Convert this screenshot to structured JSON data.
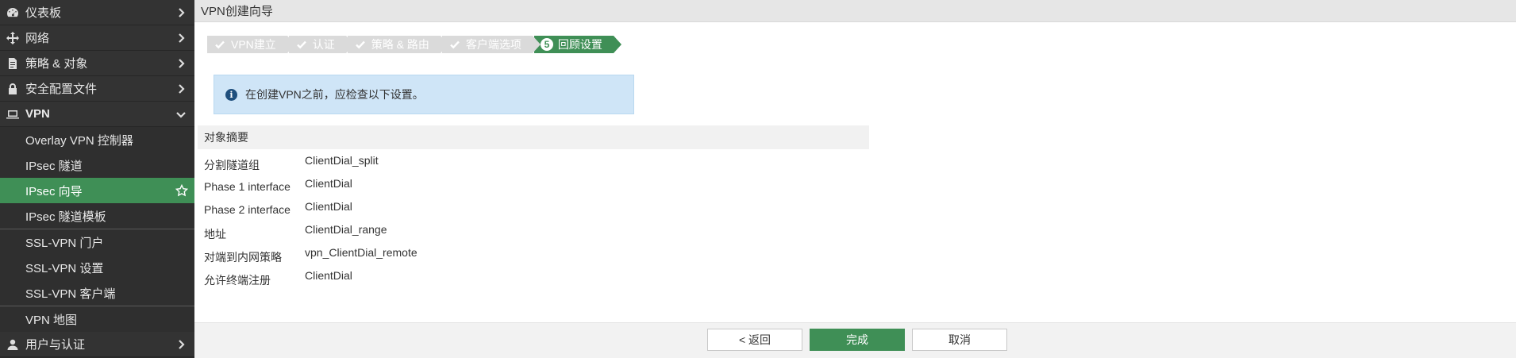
{
  "sidebar": {
    "items": [
      {
        "label": "仪表板",
        "icon": "dashboard-icon"
      },
      {
        "label": "网络",
        "icon": "network-icon"
      },
      {
        "label": "策略 & 对象",
        "icon": "policy-icon"
      },
      {
        "label": "安全配置文件",
        "icon": "lock-icon"
      },
      {
        "label": "VPN",
        "icon": "laptop-icon"
      }
    ],
    "vpn_sub": [
      {
        "label": "Overlay VPN 控制器"
      },
      {
        "label": "IPsec 隧道"
      },
      {
        "label": "IPsec 向导"
      },
      {
        "label": "IPsec 隧道模板"
      },
      {
        "label": "SSL-VPN 门户"
      },
      {
        "label": "SSL-VPN 设置"
      },
      {
        "label": "SSL-VPN 客户端"
      },
      {
        "label": "VPN 地图"
      }
    ],
    "last": {
      "label": "用户与认证",
      "icon": "user-icon"
    }
  },
  "title": "VPN创建向导",
  "steps": [
    {
      "label": "VPN建立",
      "done": true
    },
    {
      "label": "认证",
      "done": true
    },
    {
      "label": "策略 & 路由",
      "done": true
    },
    {
      "label": "客户端选项",
      "done": true
    },
    {
      "label": "回顾设置",
      "num": "5",
      "active": true
    }
  ],
  "info": {
    "text": "在创建VPN之前，应检查以下设置。"
  },
  "summary": {
    "header": "对象摘要",
    "rows": [
      {
        "key": "分割隧道组",
        "value": "ClientDial_split"
      },
      {
        "key": "Phase 1 interface",
        "value": "ClientDial"
      },
      {
        "key": "Phase 2 interface",
        "value": "ClientDial"
      },
      {
        "key": "地址",
        "value": "ClientDial_range"
      },
      {
        "key": "对端到内网策略",
        "value": "vpn_ClientDial_remote"
      },
      {
        "key": "允许终端注册",
        "value": "ClientDial"
      }
    ]
  },
  "footer": {
    "back": "< 返回",
    "finish": "完成",
    "cancel": "取消"
  },
  "colors": {
    "accent": "#3f8f56",
    "info_bg": "#cfe5f7",
    "sidebar_bg": "#2b2b2b"
  }
}
